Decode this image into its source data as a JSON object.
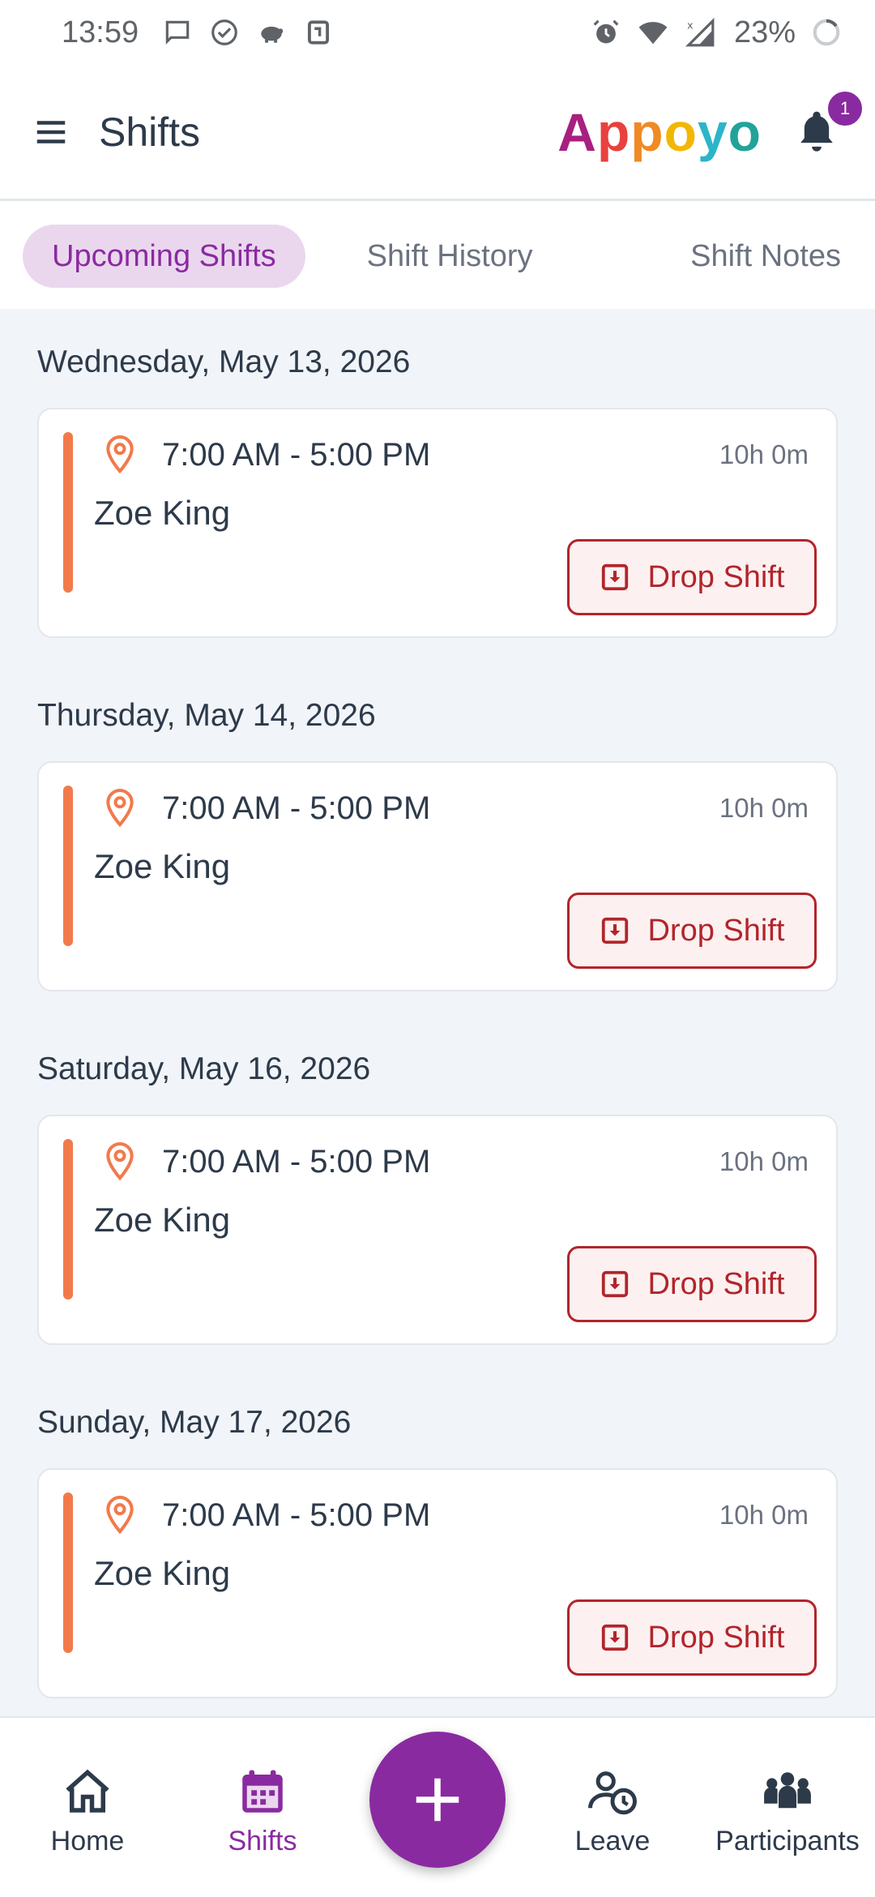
{
  "status_bar": {
    "time": "13:59",
    "battery": "23%",
    "icons_left": [
      "message-icon",
      "check-circle-icon",
      "piggy-bank-icon",
      "nfc-icon"
    ],
    "icons_right": [
      "alarm-icon",
      "wifi-icon",
      "signal-icon",
      "battery-icon"
    ]
  },
  "header": {
    "title": "Shifts",
    "brand": [
      "A",
      "p",
      "p",
      "o",
      "y",
      "o"
    ],
    "notification_count": "1"
  },
  "tabs": [
    {
      "label": "Upcoming Shifts",
      "active": true
    },
    {
      "label": "Shift History",
      "active": false
    },
    {
      "label": "Shift Notes",
      "active": false
    }
  ],
  "shifts": [
    {
      "date": "Wednesday, May 13, 2026",
      "time": "7:00 AM - 5:00 PM",
      "duration": "10h 0m",
      "name": "Zoe King",
      "action": "Drop Shift"
    },
    {
      "date": "Thursday, May 14, 2026",
      "time": "7:00 AM - 5:00 PM",
      "duration": "10h 0m",
      "name": "Zoe King",
      "action": "Drop Shift"
    },
    {
      "date": "Saturday, May 16, 2026",
      "time": "7:00 AM - 5:00 PM",
      "duration": "10h 0m",
      "name": "Zoe King",
      "action": "Drop Shift"
    },
    {
      "date": "Sunday, May 17, 2026",
      "time": "7:00 AM - 5:00 PM",
      "duration": "10h 0m",
      "name": "Zoe King",
      "action": "Drop Shift"
    }
  ],
  "bottom_nav": {
    "home": "Home",
    "shifts": "Shifts",
    "leave": "Leave",
    "participants": "Participants"
  },
  "colors": {
    "primary": "#8a2aa0",
    "accent_bar": "#f27a4a",
    "drop": "#b1252b",
    "background": "#f1f4f8"
  }
}
